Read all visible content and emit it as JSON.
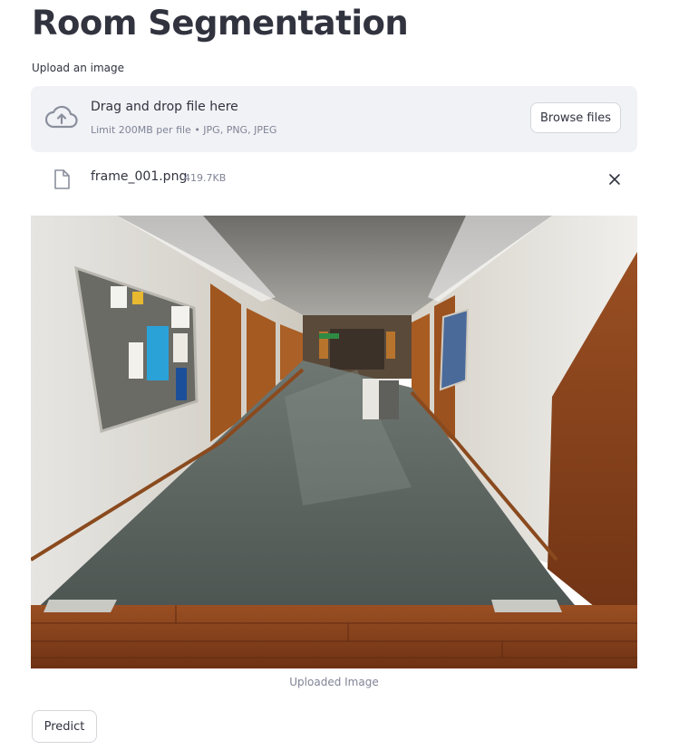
{
  "page": {
    "title": "Room Segmentation"
  },
  "uploader": {
    "label": "Upload an image",
    "dropzone_title": "Drag and drop file here",
    "dropzone_limits": "Limit 200MB per file • JPG, PNG, JPEG",
    "browse_label": "Browse files",
    "upload_icon": "cloud-upload-icon"
  },
  "uploaded_file": {
    "name": "frame_001.png",
    "size": "419.7KB",
    "file_icon": "file-icon",
    "remove_icon": "close-icon"
  },
  "image": {
    "caption": "Uploaded Image"
  },
  "actions": {
    "predict_label": "Predict"
  },
  "colors": {
    "text": "#31333f",
    "muted": "#808495",
    "dropzone_bg": "#f0f2f6",
    "border": "#d5d6db"
  }
}
